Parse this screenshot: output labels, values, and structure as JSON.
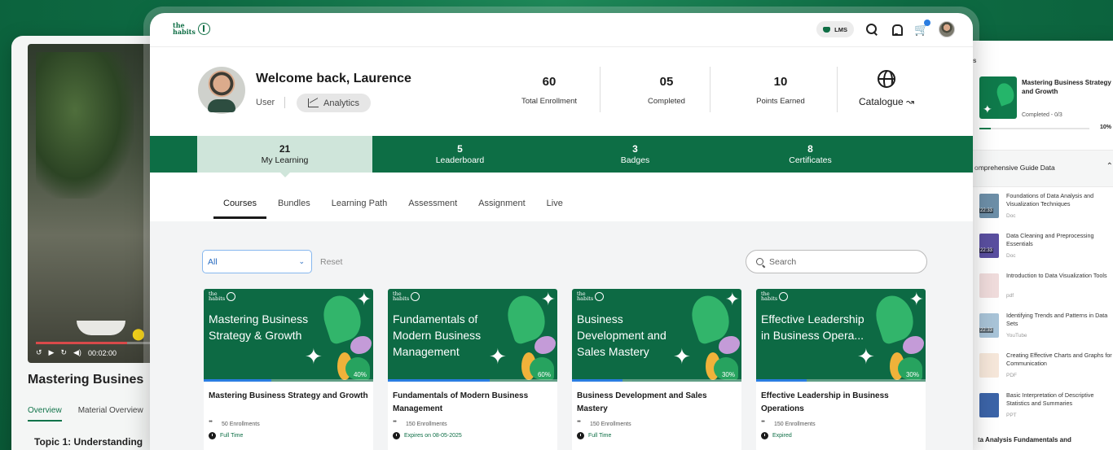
{
  "left_panel": {
    "video_time": "00:02:00",
    "course_title": "Mastering Busines",
    "tabs": [
      "Overview",
      "Material Overview"
    ],
    "active_tab": "Overview",
    "topic": "Topic 1: Understanding"
  },
  "right_panel": {
    "header": "s",
    "course_title": "Mastering Business Strategy and Growth",
    "completed": "Completed - 0/3",
    "progress_label": "10%",
    "progress": 0.1,
    "section_title": "omprehensive Guide Data",
    "items": [
      {
        "title": "Foundations of Data Analysis and Visualization Techniques",
        "type": "Doc",
        "duration": "22:33",
        "thumb_color": "#6d8fa8"
      },
      {
        "title": "Data Cleaning and Preprocessing Essentials",
        "type": "Doc",
        "duration": "22:33",
        "thumb_color": "#5a4fa0"
      },
      {
        "title": "Introduction to Data Visualization Tools",
        "type": "pdf",
        "duration": "",
        "thumb_color": "#f0dcdc"
      },
      {
        "title": "Identifying Trends and Patterns in Data Sets",
        "type": "YouTube",
        "duration": "22:33",
        "thumb_color": "#a9c4d8"
      },
      {
        "title": "Creating Effective Charts and Graphs for Communication",
        "type": "PDF",
        "duration": "",
        "thumb_color": "#f6e7da"
      },
      {
        "title": "Basic Interpretation of Descriptive Statistics and Summaries",
        "type": "PPT",
        "duration": "",
        "thumb_color": "#3c64a8"
      }
    ],
    "bottom_text": "ta Analysis Fundamentals and"
  },
  "header": {
    "logo_text": "the\nhabits",
    "lms_label": "LMS"
  },
  "profile": {
    "welcome": "Welcome back, Laurence",
    "role": "User",
    "analytics_label": "Analytics"
  },
  "stats": [
    {
      "value": "60",
      "label": "Total Enrollment"
    },
    {
      "value": "05",
      "label": "Completed"
    },
    {
      "value": "10",
      "label": "Points Earned"
    }
  ],
  "catalogue_label": "Catalogue ↝",
  "strip_tabs": [
    {
      "count": "21",
      "label": "My Learning",
      "active": true
    },
    {
      "count": "5",
      "label": "Leaderboard",
      "active": false
    },
    {
      "count": "3",
      "label": "Badges",
      "active": false
    },
    {
      "count": "8",
      "label": "Certificates",
      "active": false
    }
  ],
  "sub_tabs": [
    "Courses",
    "Bundles",
    "Learning Path",
    "Assessment",
    "Assignment",
    "Live"
  ],
  "filter": {
    "selected": "All",
    "reset_label": "Reset",
    "search_placeholder": "Search"
  },
  "courses": [
    {
      "banner_title": "Mastering Business Strategy & Growth",
      "title": "Mastering Business Strategy and Growth",
      "enrollments": "50 Enrollments",
      "status": "Full Time",
      "progress_label": "40%",
      "progress": 0.4
    },
    {
      "banner_title": "Fundamentals of Modern Business Management",
      "title": "Fundamentals of Modern Business Management",
      "enrollments": "150 Enrollments",
      "status": "Expires on 08-05-2025",
      "progress_label": "60%",
      "progress": 0.6
    },
    {
      "banner_title": "Business Development and Sales Mastery",
      "title": "Business Development and Sales Mastery",
      "enrollments": "150 Enrollments",
      "status": "Full Time",
      "progress_label": "30%",
      "progress": 0.3
    },
    {
      "banner_title": "Effective Leadership in Business Opera...",
      "title": "Effective Leadership in Business Operations",
      "enrollments": "150 Enrollments",
      "status": "Expired",
      "progress_label": "30%",
      "progress": 0.3
    }
  ],
  "colors": {
    "brand_green": "#0d6e45",
    "accent_blue": "#2a7de1",
    "active_tab_bg": "#cfe5da"
  }
}
